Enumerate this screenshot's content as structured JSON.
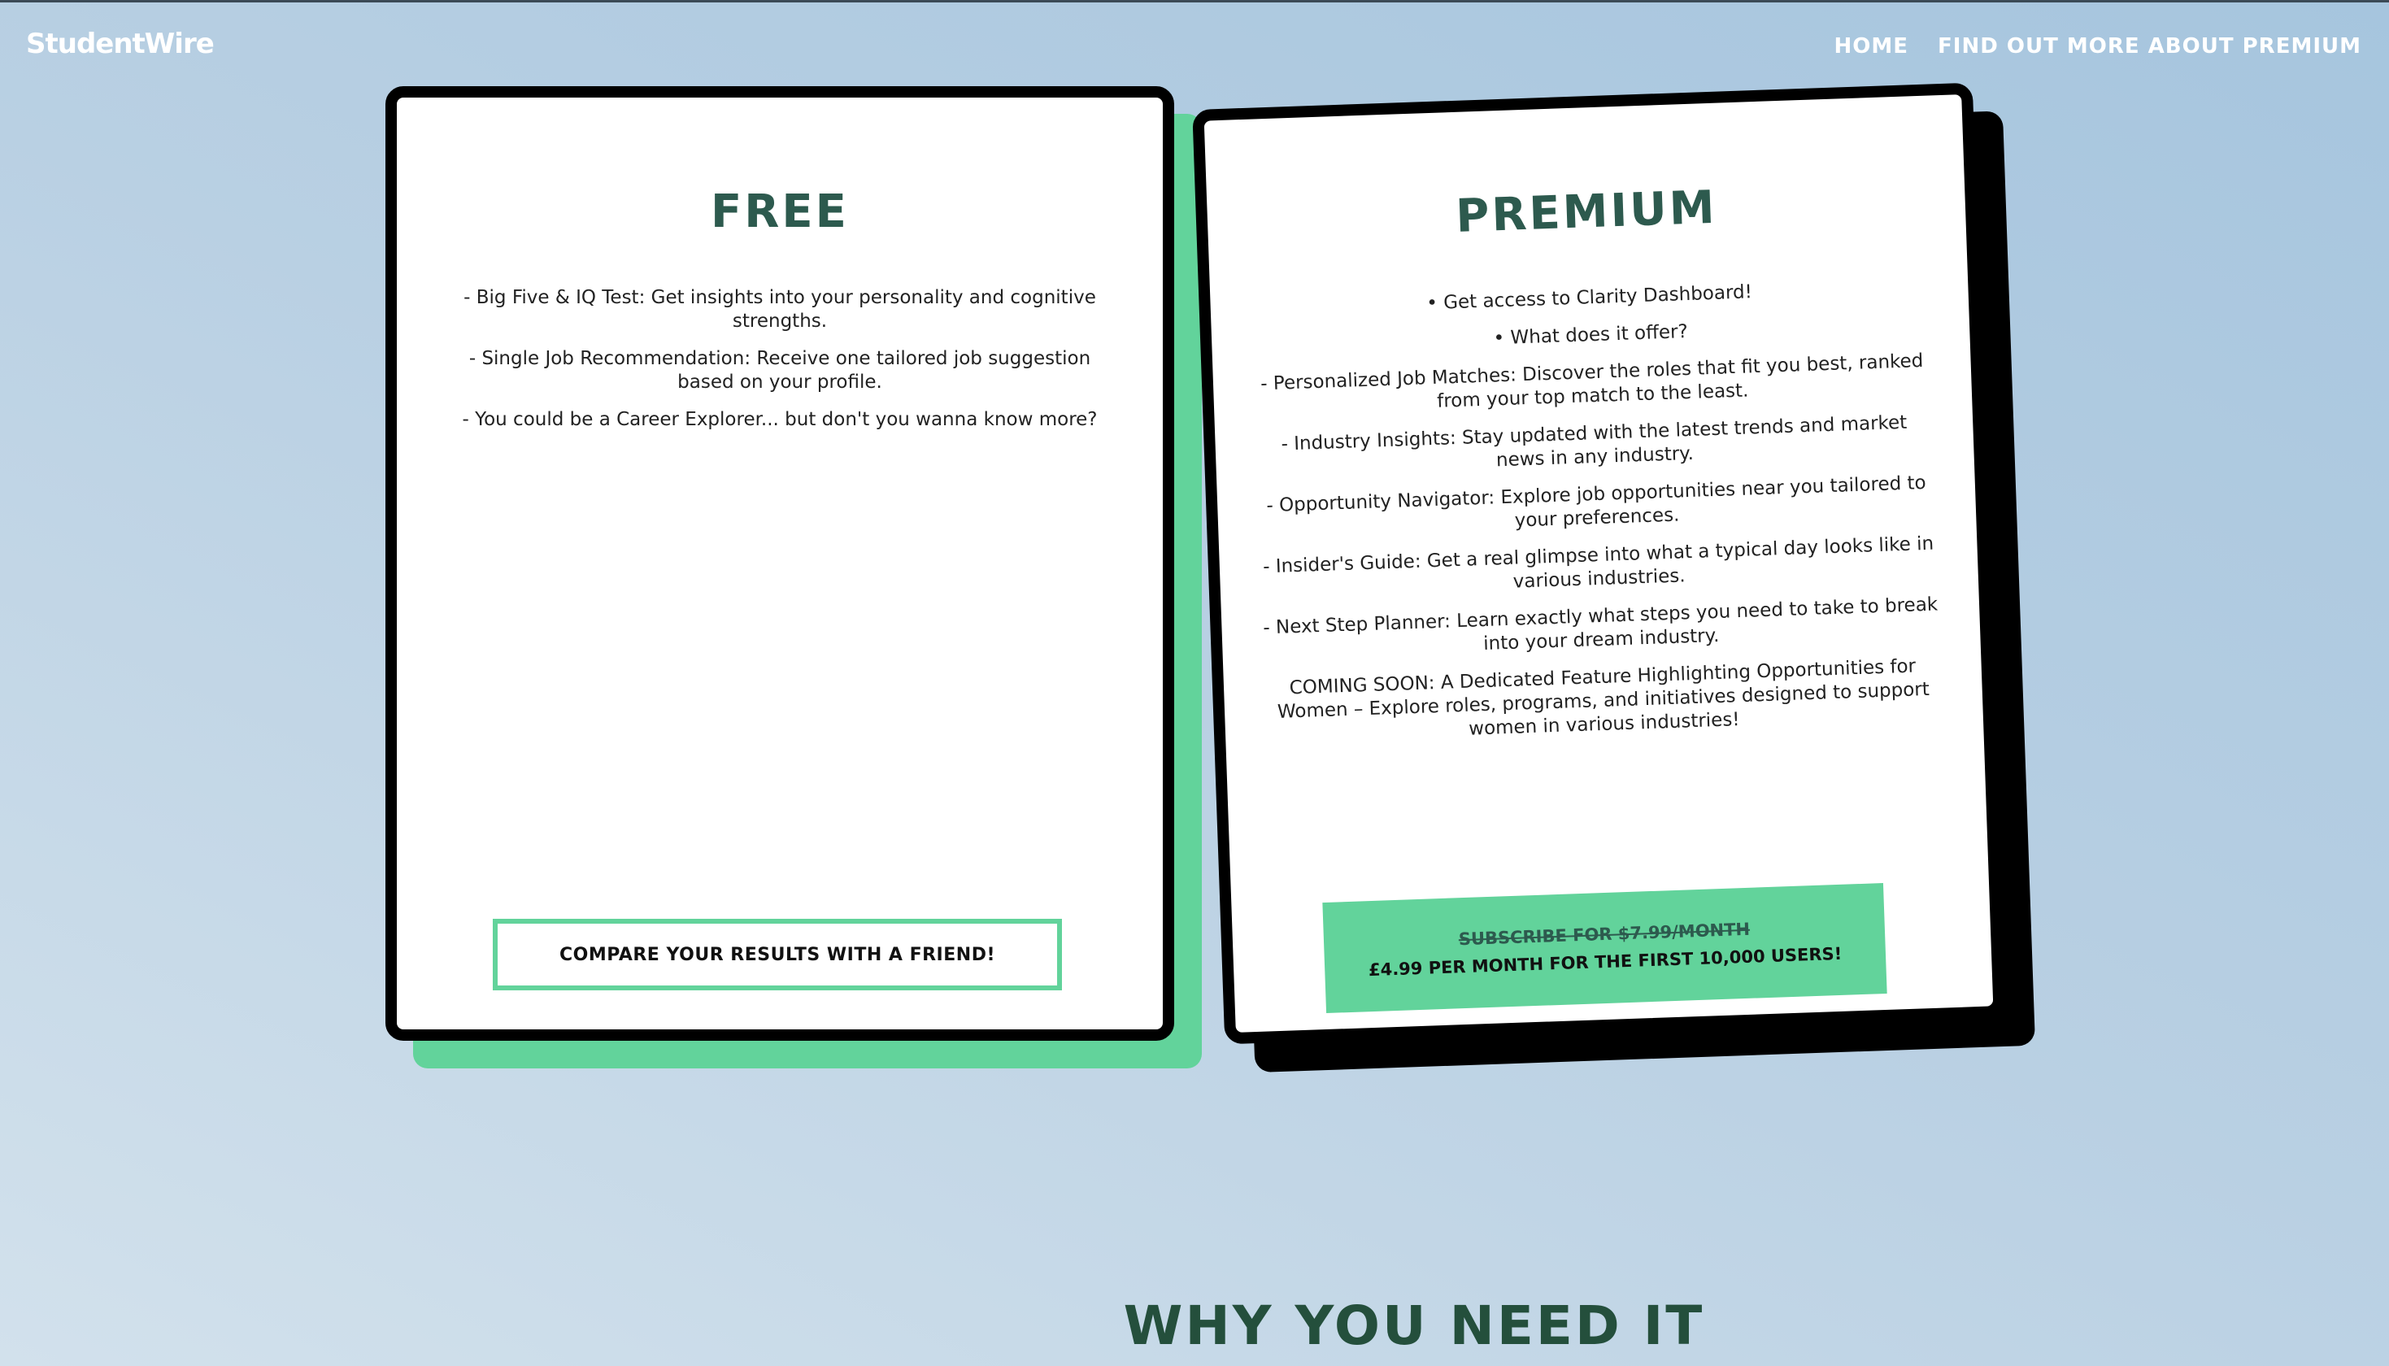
{
  "header": {
    "brand": "StudentWire",
    "nav": [
      {
        "label": "HOME"
      },
      {
        "label": "FIND OUT MORE ABOUT PREMIUM"
      }
    ]
  },
  "free_plan": {
    "title": "FREE",
    "features": [
      "- Big Five & IQ Test: Get insights into your personality and cognitive strengths.",
      "- Single Job Recommendation: Receive one tailored job suggestion based on your profile.",
      "- You could be a Career Explorer... but don't you wanna know more?"
    ],
    "button_label": "COMPARE YOUR RESULTS WITH A FRIEND!"
  },
  "premium_plan": {
    "title": "PREMIUM",
    "features": [
      "• Get access to Clarity Dashboard!",
      "• What does it offer?",
      "- Personalized Job Matches: Discover the roles that fit you best, ranked from your top match to the least.",
      "- Industry Insights: Stay updated with the latest trends and market news in any industry.",
      "- Opportunity Navigator: Explore job opportunities near you tailored to your preferences.",
      "- Insider's Guide: Get a real glimpse into what a typical day looks like in various industries.",
      "- Next Step Planner: Learn exactly what steps you need to take to break into your dream industry.",
      "COMING SOON: A Dedicated Feature Highlighting Opportunities for Women – Explore roles, programs, and initiatives designed to support women in various industries!"
    ],
    "button_old_price": "SUBSCRIBE FOR $7.99/MONTH",
    "button_offer": "£4.99 PER MONTH FOR THE FIRST 10,000 USERS!"
  },
  "section": {
    "heading": "WHY YOU NEED IT"
  },
  "colors": {
    "accent_green": "#62d39b",
    "heading_green": "#2d5a4e",
    "card_border": "#000000"
  }
}
